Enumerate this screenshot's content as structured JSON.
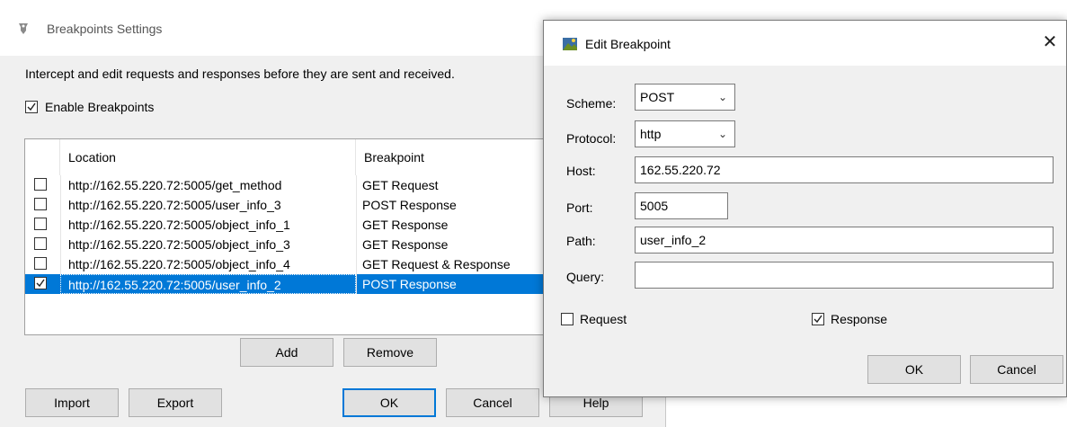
{
  "settings_dialog": {
    "title": "Breakpoints Settings",
    "description": "Intercept and edit requests and responses before they are sent and received.",
    "enable_label": "Enable Breakpoints",
    "enable_checked": true,
    "columns": [
      "Location",
      "Breakpoint"
    ],
    "rows": [
      {
        "checked": false,
        "location": "http://162.55.220.72:5005/get_method",
        "breakpoint": "GET Request",
        "selected": false
      },
      {
        "checked": false,
        "location": "http://162.55.220.72:5005/user_info_3",
        "breakpoint": "POST Response",
        "selected": false
      },
      {
        "checked": false,
        "location": "http://162.55.220.72:5005/object_info_1",
        "breakpoint": "GET Response",
        "selected": false
      },
      {
        "checked": false,
        "location": "http://162.55.220.72:5005/object_info_3",
        "breakpoint": "GET Response",
        "selected": false
      },
      {
        "checked": false,
        "location": "http://162.55.220.72:5005/object_info_4",
        "breakpoint": "GET Request & Response",
        "selected": false
      },
      {
        "checked": true,
        "location": "http://162.55.220.72:5005/user_info_2",
        "breakpoint": "POST Response",
        "selected": true
      }
    ],
    "buttons": {
      "add": "Add",
      "remove": "Remove",
      "import": "Import",
      "export": "Export",
      "ok": "OK",
      "cancel": "Cancel",
      "help": "Help"
    }
  },
  "edit_dialog": {
    "title": "Edit Breakpoint",
    "close_glyph": "✕",
    "scheme": {
      "label": "Scheme:",
      "value": "POST"
    },
    "protocol": {
      "label": "Protocol:",
      "value": "http"
    },
    "host": {
      "label": "Host:",
      "value": "162.55.220.72"
    },
    "port": {
      "label": "Port:",
      "value": "5005"
    },
    "path": {
      "label": "Path:",
      "value": "user_info_2"
    },
    "query": {
      "label": "Query:",
      "value": ""
    },
    "request": {
      "label": "Request",
      "checked": false
    },
    "response": {
      "label": "Response",
      "checked": true
    },
    "buttons": {
      "ok": "OK",
      "cancel": "Cancel"
    }
  },
  "colors": {
    "selection": "#0078d7",
    "dialog_bg": "#f0f0f0"
  }
}
